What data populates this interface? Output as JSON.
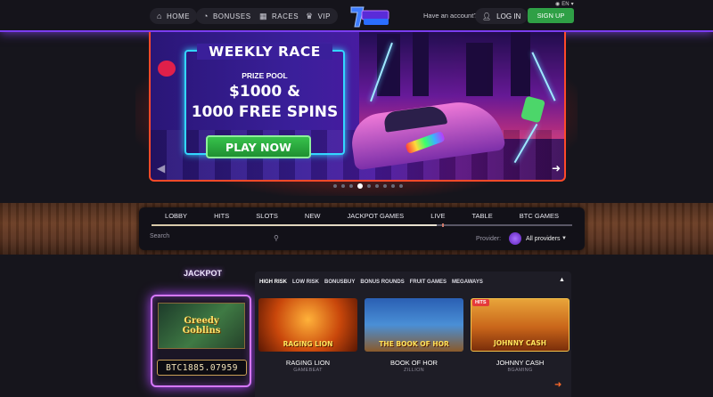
{
  "nav": {
    "home": "HOME",
    "bonuses": "BONUSES",
    "races": "RACES",
    "vip": "VIP",
    "have_account": "Have an account?",
    "login": "LOG IN",
    "signup": "SIGN UP",
    "lang": "EN"
  },
  "banner": {
    "title": "WEEKLY RACE",
    "prize_label": "PRIZE POOL",
    "prize_amount": "$1000 &\n1000 FREE SPINS",
    "cta": "PLAY NOW",
    "prev": "◀",
    "next": "➜",
    "slide_count": 9,
    "active_slide": 4
  },
  "categories": [
    "LOBBY",
    "HITS",
    "SLOTS",
    "NEW",
    "JACKPOT GAMES",
    "LIVE",
    "TABLE",
    "BTC GAMES"
  ],
  "search": {
    "placeholder": "Search"
  },
  "provider": {
    "label": "Provider:",
    "value": "All providers"
  },
  "jackpot": {
    "title": "JACKPOT",
    "game": "Greedy\nGoblins",
    "amount": "BTC1885.07959"
  },
  "filters": [
    "HIGH RISK",
    "LOW RISK",
    "BONUSBUY",
    "BONUS ROUNDS",
    "FRUIT GAMES",
    "MEGAWAYS"
  ],
  "games": [
    {
      "name": "RAGING LION",
      "provider": "GAMEBEAT",
      "art": "RAGING LION",
      "badge": ""
    },
    {
      "name": "BOOK OF HOR",
      "provider": "ZILLION",
      "art": "THE BOOK OF HOR",
      "badge": ""
    },
    {
      "name": "JOHNNY CASH",
      "provider": "BGAMING",
      "art": "JOHNNY CASH",
      "badge": "HITS"
    }
  ],
  "colors": {
    "accent": "#7b3df0",
    "cta": "#2fa046",
    "banner_border": "#ff4a2a",
    "jackpot_glow": "#b046ff"
  }
}
